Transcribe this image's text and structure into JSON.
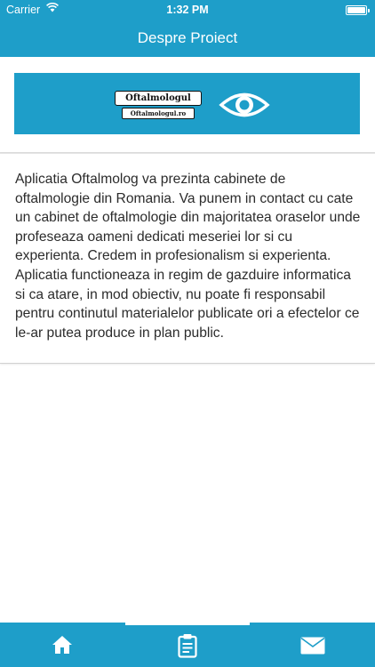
{
  "status_bar": {
    "carrier": "Carrier",
    "time": "1:32 PM"
  },
  "nav": {
    "title": "Despre Proiect"
  },
  "banner": {
    "logo_title": "Oftalmologul",
    "logo_url": "Oftalmologul.ro",
    "eye_icon": "eye-icon"
  },
  "about": {
    "text": "Aplicatia Oftalmolog va prezinta cabinete de oftalmologie din Romania. Va punem in contact cu cate un cabinet de oftalmologie din majoritatea oraselor unde profeseaza oameni dedicati meseriei lor si cu experienta.  Credem in profesionalism si experienta.  Aplicatia functioneaza in regim de gazduire informatica si ca atare, in mod obiectiv, nu poate fi responsabil pentru continutul materialelor publicate ori a efectelor ce le-ar putea produce in plan public."
  },
  "tabbar": {
    "tabs": [
      {
        "icon": "home-icon",
        "selected": false
      },
      {
        "icon": "clipboard-icon",
        "selected": true
      },
      {
        "icon": "mail-icon",
        "selected": false
      }
    ]
  },
  "colors": {
    "accent": "#1e9ec9",
    "text": "#2b2b2b"
  }
}
